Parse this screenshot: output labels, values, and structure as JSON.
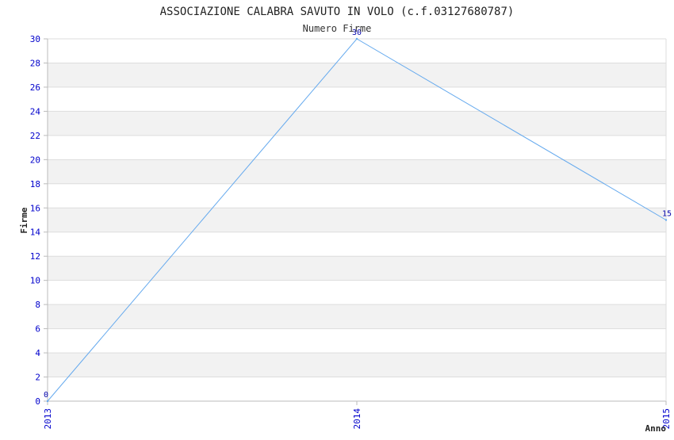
{
  "chart_data": {
    "type": "line",
    "title": "ASSOCIAZIONE CALABRA SAVUTO IN VOLO (c.f.03127680787)",
    "subtitle": "Numero Firme",
    "xlabel": "Anno",
    "ylabel": "Firme",
    "categories": [
      "2013",
      "2014",
      "2015"
    ],
    "series": [
      {
        "values": [
          0,
          30,
          15
        ]
      }
    ],
    "ylim": [
      0,
      30
    ],
    "yticks": [
      0,
      2,
      4,
      6,
      8,
      10,
      12,
      14,
      16,
      18,
      20,
      22,
      24,
      26,
      28,
      30
    ],
    "grid": true,
    "band_colors": [
      "#ffffff",
      "#f2f2f2"
    ],
    "line_color": "#66aaee",
    "tick_color": "#0000cc"
  }
}
